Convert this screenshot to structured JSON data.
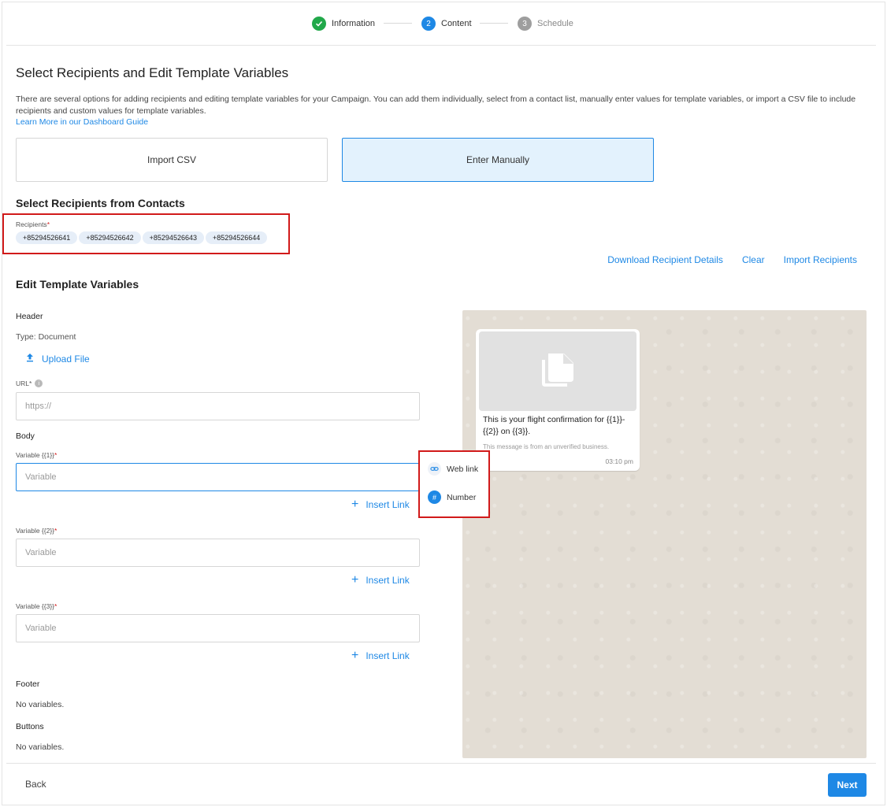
{
  "stepper": {
    "steps": [
      {
        "label": "Information",
        "marker": "✓",
        "state": "done"
      },
      {
        "label": "Content",
        "marker": "2",
        "state": "active"
      },
      {
        "label": "Schedule",
        "marker": "3",
        "state": "todo"
      }
    ]
  },
  "page": {
    "title": "Select Recipients and Edit Template Variables",
    "description": "There are several options for adding recipients and editing template variables for your Campaign. You can add them individually, select from a contact list, manually enter values for template variables, or import a CSV file to include recipients and custom values for template variables.",
    "learn_more": "Learn More in our Dashboard Guide"
  },
  "options": {
    "import_csv": "Import CSV",
    "enter_manually": "Enter Manually",
    "selected": "Enter Manually"
  },
  "recipients": {
    "section_title": "Select Recipients from Contacts",
    "label": "Recipients",
    "required_mark": "*",
    "chips": [
      "+85294526641",
      "+85294526642",
      "+85294526643",
      "+85294526644"
    ]
  },
  "actions": {
    "download": "Download Recipient Details",
    "clear": "Clear",
    "import": "Import Recipients"
  },
  "template": {
    "section_title": "Edit Template Variables",
    "header_label": "Header",
    "header_type": "Type: Document",
    "upload_label": "Upload File",
    "url_label": "URL*",
    "url_placeholder": "https://",
    "body_label": "Body",
    "variables": [
      {
        "label": "Variable {{1}}",
        "placeholder": "Variable",
        "insert_link": "Insert Link"
      },
      {
        "label": "Variable {{2}}",
        "placeholder": "Variable",
        "insert_link": "Insert Link"
      },
      {
        "label": "Variable {{3}}",
        "placeholder": "Variable",
        "insert_link": "Insert Link"
      }
    ],
    "footer_label": "Footer",
    "footer_value": "No variables.",
    "buttons_label": "Buttons",
    "buttons_value": "No variables."
  },
  "insert_menu": {
    "web_link": "Web link",
    "number": "Number"
  },
  "preview": {
    "message": "This is your flight confirmation for {{1}}-{{2}} on {{3}}.",
    "note": "This message is from an unverified business.",
    "time": "03:10 pm"
  },
  "footer": {
    "back": "Back",
    "next": "Next"
  },
  "colors": {
    "accent": "#1e88e5",
    "success": "#21a84a",
    "highlight_box": "#d11a1a",
    "selected_card_bg": "#e3f2fd"
  }
}
